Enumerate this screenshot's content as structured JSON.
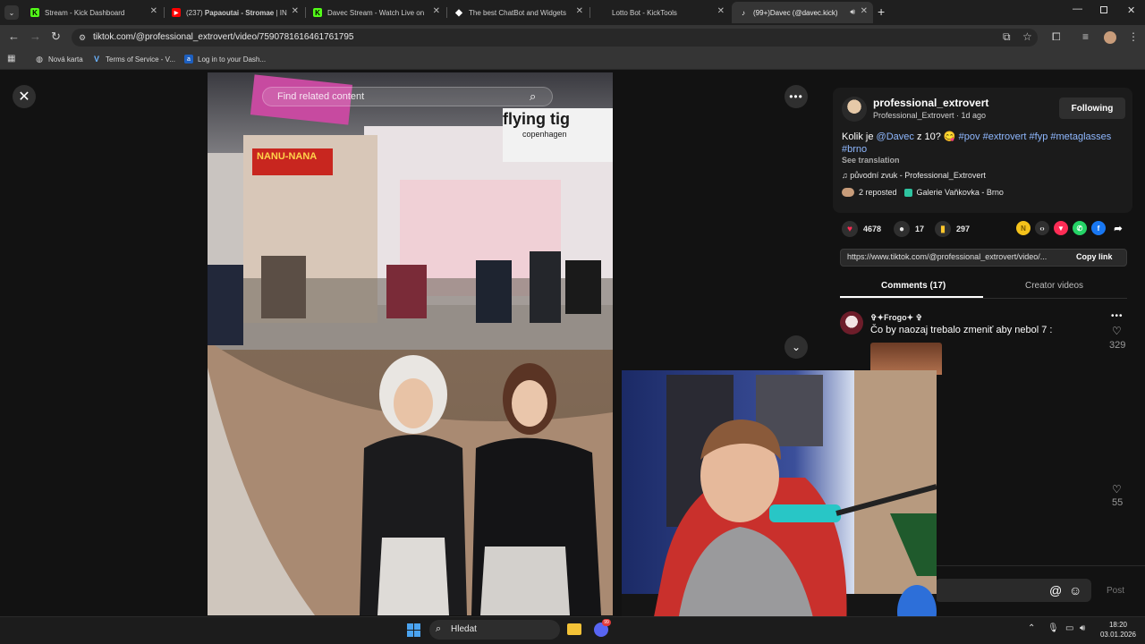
{
  "browser": {
    "tabs": [
      {
        "title": "Stream - Kick Dashboard",
        "favicon": "kick-icon",
        "color": "#53fc18"
      },
      {
        "title_prefix": "(237) ",
        "title_bold": "Papaoutai - Stromae",
        "title_suffix": " | IN",
        "favicon": "youtube-icon",
        "color": "#ff0000"
      },
      {
        "title": "Davec Stream - Watch Live on",
        "favicon": "kick-icon",
        "color": "#53fc18"
      },
      {
        "title": "The best ChatBot and Widgets",
        "favicon": "diamond-icon",
        "color": "#ffffff"
      },
      {
        "title": "Lotto Bot - KickTools",
        "favicon": "blank-icon",
        "color": "#888888"
      },
      {
        "title": "(99+)Davec (@davec.kick) |",
        "favicon": "tiktok-icon",
        "color": "#ffffff",
        "active": true
      }
    ],
    "url": "tiktok.com/@professional_extrovert/video/7590781616461761795",
    "bookmarks": [
      {
        "label": "Nová karta",
        "icon": "globe-icon"
      },
      {
        "label": "Terms of Service - V...",
        "icon": "v-icon"
      },
      {
        "label": "Log in to your Dash...",
        "icon": "a-icon"
      }
    ]
  },
  "video": {
    "search_placeholder": "Find related content",
    "store_sign_1": "NANU-NANA",
    "store_sign_2": "flying tig",
    "store_sign_3": "copenhagen"
  },
  "post": {
    "username": "professional_extrovert",
    "display": "Professional_Extrovert · 1d ago",
    "follow_label": "Following",
    "caption_text": "Kolik je ",
    "caption_mention": "@Davec",
    "caption_mid": " z 10? 😋 ",
    "caption_tags": "#pov #extrovert #fyp #metaglasses #brno",
    "see_translation": "See translation",
    "sound": "♫  původní zvuk - Professional_Extrovert",
    "reposted": "2 reposted",
    "location": "Galerie Vaňkovka - Brno",
    "likes": "4678",
    "comments": "17",
    "saves": "297",
    "share_link": "https://www.tiktok.com/@professional_extrovert/video/...",
    "copy_link": "Copy link",
    "tab_comments": "Comments (17)",
    "tab_creator": "Creator videos"
  },
  "comments": [
    {
      "name": "✞✦Frogo✦ ✞",
      "text": "Čo by naozaj trebalo zmeniť aby nebol 7 :",
      "likes": "329"
    },
    {
      "likes": "55"
    }
  ],
  "comment_input": {
    "post_label": "Post"
  },
  "taskbar": {
    "search_label": "Hledat",
    "badge": "99",
    "time": "18:20",
    "date": "03.01.2026"
  }
}
